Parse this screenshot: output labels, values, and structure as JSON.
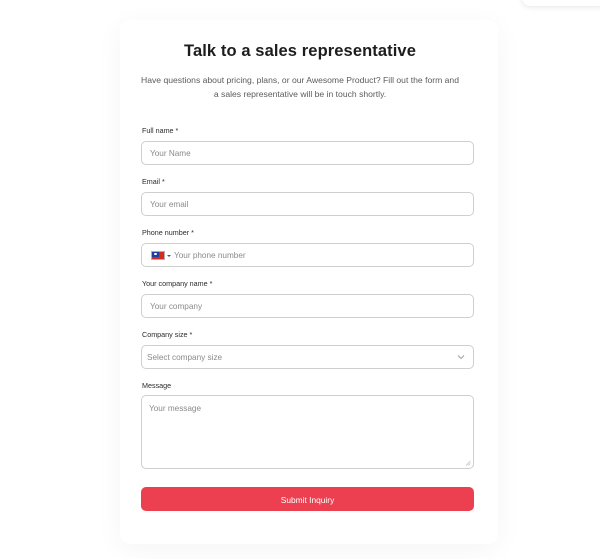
{
  "header": {
    "title": "Talk to a sales representative",
    "subtitle": "Have questions about pricing, plans, or our Awesome Product? Fill out the form and a sales representative will be in touch shortly."
  },
  "form": {
    "full_name": {
      "label": "Full name *",
      "placeholder": "Your Name",
      "value": ""
    },
    "email": {
      "label": "Email *",
      "placeholder": "Your email",
      "value": ""
    },
    "phone": {
      "label": "Phone number *",
      "placeholder": "Your phone number",
      "country_flag": "taiwan-flag-icon",
      "value": ""
    },
    "company_name": {
      "label": "Your company name *",
      "placeholder": "Your company",
      "value": ""
    },
    "company_size": {
      "label": "Company size *",
      "selected": "Select company size"
    },
    "message": {
      "label": "Message",
      "placeholder": "Your message",
      "value": ""
    },
    "submit_label": "Submit Inquiry"
  },
  "colors": {
    "accent": "#ec4050",
    "border": "#cfcfcf",
    "title": "#1d1d1f",
    "placeholder": "#8a8a8a"
  }
}
